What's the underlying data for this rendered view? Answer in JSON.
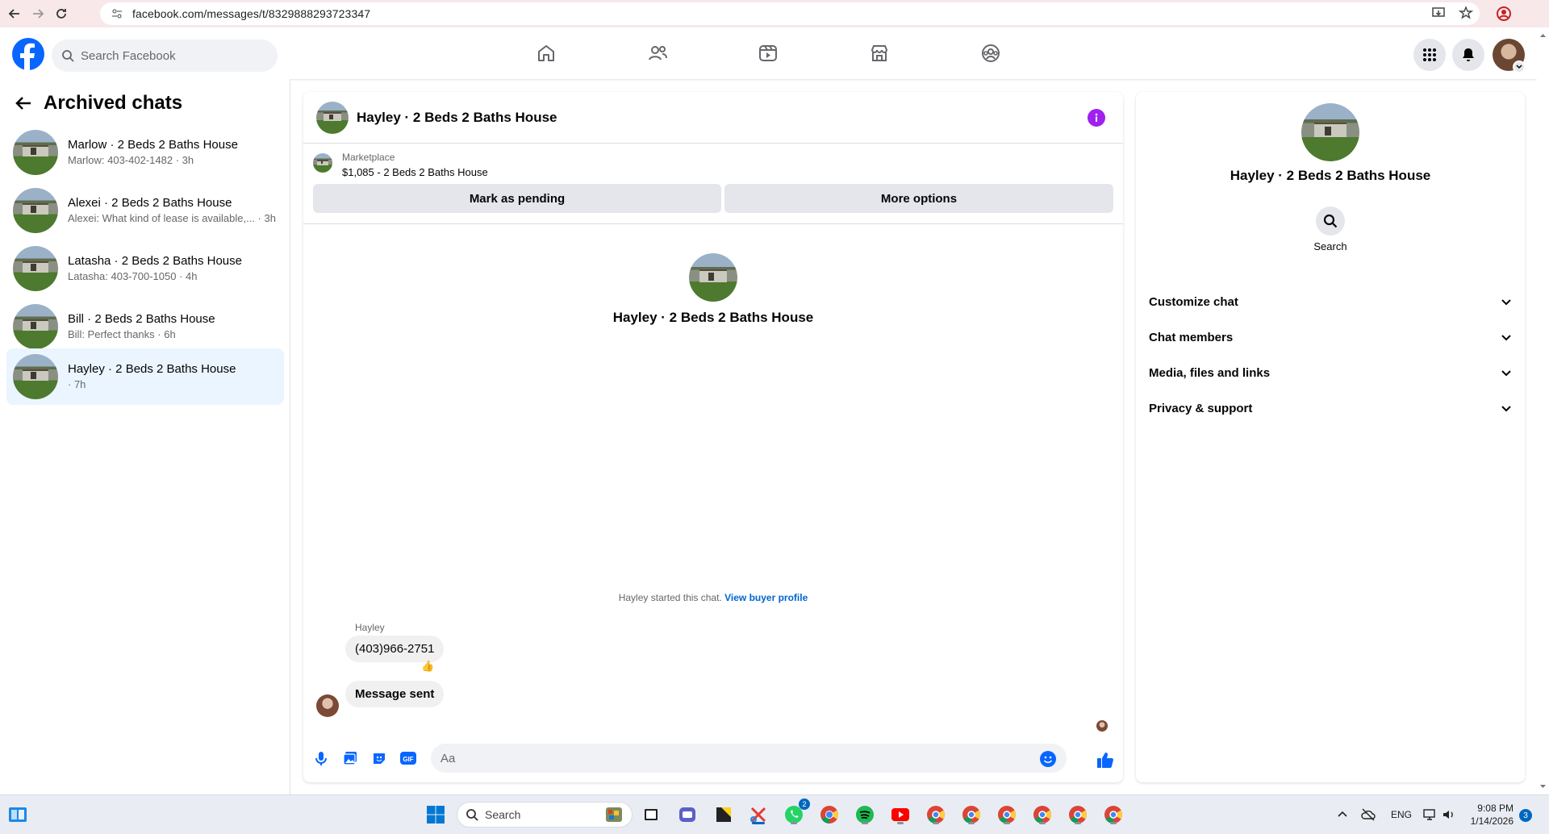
{
  "browser": {
    "url": "facebook.com/messages/t/8329888293723347"
  },
  "header": {
    "search_placeholder": "Search Facebook"
  },
  "left_panel": {
    "title": "Archived chats",
    "chats": [
      {
        "name": "Marlow · 2 Beds 2 Baths House",
        "snippet": "Marlow: 403-402-1482 · 3h",
        "active": false
      },
      {
        "name": "Alexei · 2 Beds 2 Baths House",
        "snippet": "Alexei: What kind of lease is available,... · 3h",
        "active": false
      },
      {
        "name": "Latasha · 2 Beds 2 Baths House",
        "snippet": "Latasha: 403-700-1050 · 4h",
        "active": false
      },
      {
        "name": "Bill · 2 Beds 2 Baths House",
        "snippet": "Bill: Perfect thanks · 6h",
        "active": false
      },
      {
        "name": "Hayley · 2 Beds 2 Baths House",
        "snippet": "· 7h",
        "active": true
      }
    ]
  },
  "conversation": {
    "title": "Hayley · 2 Beds 2 Baths House",
    "marketplace_label": "Marketplace",
    "marketplace_listing": "$1,085 - 2 Beds 2 Baths House",
    "mark_pending_label": "Mark as pending",
    "more_options_label": "More options",
    "profile_name": "Hayley · 2 Beds 2 Baths House",
    "started_text": "Hayley started this chat.",
    "view_buyer_profile": "View buyer profile",
    "sender_name": "Hayley",
    "messages": [
      {
        "text": "(403)966-2751",
        "reaction": "👍"
      },
      {
        "text": "Message sent"
      }
    ],
    "composer_placeholder": "Aa"
  },
  "right_panel": {
    "name": "Hayley · 2 Beds 2 Baths House",
    "search_label": "Search",
    "sections": [
      "Customize chat",
      "Chat members",
      "Media, files and links",
      "Privacy & support"
    ]
  },
  "taskbar": {
    "search_placeholder": "Search",
    "whatsapp_badge": "2",
    "language": "ENG",
    "time": "9:08 PM",
    "date": "1/14/2026",
    "notification_count": "3"
  },
  "colors": {
    "facebook_blue": "#0866ff",
    "link_blue": "#0064d1",
    "info_purple": "#a020f0",
    "active_chat_bg": "#ebf5ff"
  }
}
